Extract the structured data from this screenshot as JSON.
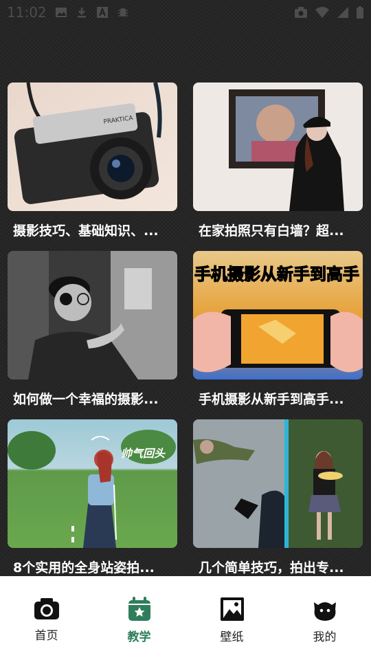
{
  "status": {
    "time": "11:02"
  },
  "cards": [
    {
      "title": "摄影技巧、基础知识、..."
    },
    {
      "title": "在家拍照只有白墙？超..."
    },
    {
      "title": "如何做一个幸福的摄影..."
    },
    {
      "title": "手机摄影从新手到高手..."
    },
    {
      "title": "8个实用的全身站姿拍..."
    },
    {
      "title": "几个简单技巧，拍出专..."
    }
  ],
  "thumb_text": {
    "card1_brand": "PRAKTICA",
    "card4_banner": "手机摄影从新手到高手",
    "card5_caption": "帅气回头"
  },
  "nav": [
    {
      "label": "首页",
      "icon": "camera-icon"
    },
    {
      "label": "教学",
      "icon": "calendar-star-icon",
      "active": true
    },
    {
      "label": "壁纸",
      "icon": "image-icon"
    },
    {
      "label": "我的",
      "icon": "face-icon"
    }
  ],
  "colors": {
    "accent": "#2f7d5a",
    "nav_bg": "#ffffff",
    "page_bg": "#232323"
  }
}
